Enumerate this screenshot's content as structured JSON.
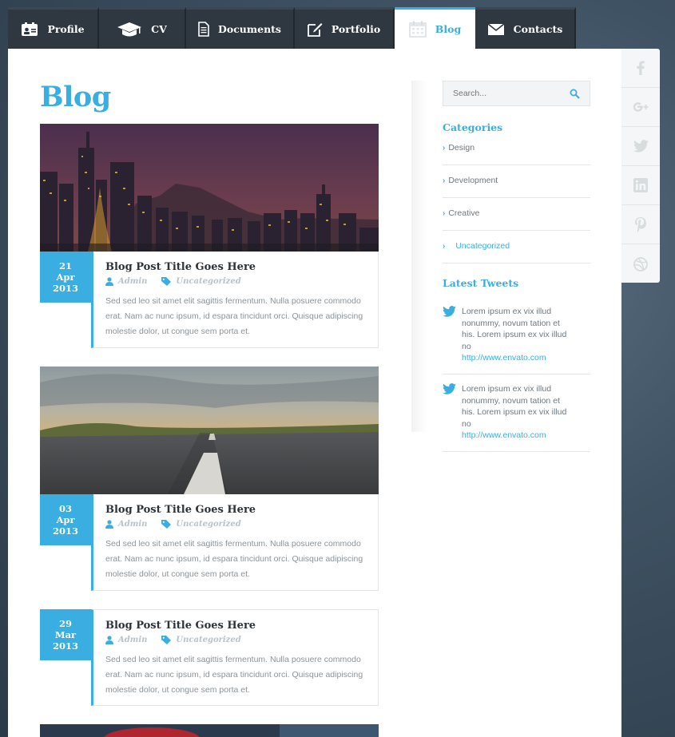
{
  "nav": {
    "tabs": [
      {
        "label": "Profile",
        "icon": "id-card-icon"
      },
      {
        "label": "CV",
        "icon": "graduation-cap-icon"
      },
      {
        "label": "Documents",
        "icon": "document-icon"
      },
      {
        "label": "Portfolio",
        "icon": "edit-icon"
      },
      {
        "label": "Blog",
        "icon": "calendar-icon",
        "active": true
      },
      {
        "label": "Contacts",
        "icon": "envelope-icon"
      }
    ]
  },
  "page": {
    "title": "Blog"
  },
  "posts": [
    {
      "day": "21",
      "month": "Apr",
      "year": "2013",
      "title": "Blog Post Title Goes Here",
      "author": "Admin",
      "category": "Uncategorized",
      "excerpt": "Sed sed leo sit amet elit sagittis fermentum. Nulla posuere commodo erat. Nam ac nunc ipsum, id espara tincidunt orci. Quisque adipiscing molestie dolor, ut congue sem porta et.",
      "image": "city-skyline"
    },
    {
      "day": "03",
      "month": "Apr",
      "year": "2013",
      "title": "Blog Post Title Goes Here",
      "author": "Admin",
      "category": "Uncategorized",
      "excerpt": "Sed sed leo sit amet elit sagittis fermentum. Nulla posuere commodo erat. Nam ac nunc ipsum, id espara tincidunt orci. Quisque adipiscing molestie dolor, ut congue sem porta et.",
      "image": "road"
    },
    {
      "day": "29",
      "month": "Mar",
      "year": "2013",
      "title": "Blog Post Title Goes Here",
      "author": "Admin",
      "category": "Uncategorized",
      "excerpt": "Sed sed leo sit amet elit sagittis fermentum. Nulla posuere commodo erat. Nam ac nunc ipsum, id espara tincidunt orci. Quisque adipiscing molestie dolor, ut congue sem porta et."
    }
  ],
  "sidebar": {
    "search_placeholder": "Search...",
    "categories_title": "Categories",
    "categories": [
      "Design",
      "Development",
      "Creative",
      "Uncategorized"
    ],
    "tweets_title": "Latest Tweets",
    "tweets": [
      {
        "text": "Lorem ipsum ex vix illud nonummy, novum tation et his. Lorem ipsum ex vix illud no",
        "link": "http://www.envato.com"
      },
      {
        "text": "Lorem ipsum ex vix illud nonummy, novum tation et his. Lorem ipsum ex vix illud no",
        "link": "http://www.envato.com"
      }
    ]
  },
  "social": [
    "facebook-icon",
    "google-plus-icon",
    "twitter-icon",
    "linkedin-icon",
    "pinterest-icon",
    "dribbble-icon"
  ],
  "colors": {
    "accent": "#3aaee0",
    "nav_bg": "#2f3840",
    "text_dark": "#2d3338"
  }
}
